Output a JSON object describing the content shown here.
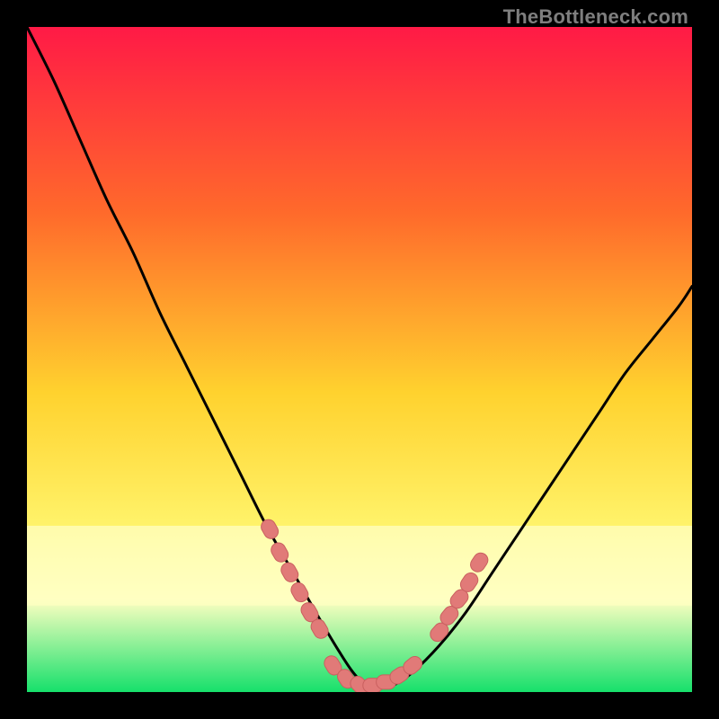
{
  "watermark": "TheBottleneck.com",
  "colors": {
    "frame_bg": "#000000",
    "gradient_top": "#ff1a46",
    "gradient_mid_upper": "#ff6a2b",
    "gradient_mid": "#ffd22e",
    "gradient_mid_lower": "#fff36a",
    "gradient_pale_band": "#ffffc2",
    "gradient_bottom": "#16e06b",
    "curve": "#000000",
    "marker_fill": "#e17a78",
    "marker_stroke": "#c9605f"
  },
  "chart_data": {
    "type": "line",
    "title": "",
    "xlabel": "",
    "ylabel": "",
    "xlim": [
      0,
      100
    ],
    "ylim": [
      0,
      100
    ],
    "grid": false,
    "legend": false,
    "comment": "Bottleneck-style V-curve. x is a normalized component-ratio axis (0-100), y is bottleneck percentage (0 = no bottleneck, 100 = full bottleneck). Values are read off the plot by position against the square frame; no numeric axis labels are rendered in the image.",
    "series": [
      {
        "name": "bottleneck-curve",
        "x": [
          0,
          4,
          8,
          12,
          16,
          20,
          24,
          28,
          32,
          36,
          40,
          44,
          47,
          49,
          51,
          53,
          55,
          58,
          62,
          66,
          70,
          74,
          78,
          82,
          86,
          90,
          94,
          98,
          100
        ],
        "y": [
          100,
          92,
          83,
          74,
          66,
          57,
          49,
          41,
          33,
          25,
          18,
          11,
          6,
          3,
          1,
          1,
          1,
          3,
          7,
          12,
          18,
          24,
          30,
          36,
          42,
          48,
          53,
          58,
          61
        ]
      }
    ],
    "markers": [
      {
        "name": "left-arm-dots",
        "x": [
          36.5,
          38.0,
          39.5,
          41.0,
          42.5,
          44.0
        ],
        "y": [
          24.5,
          21.0,
          18.0,
          15.0,
          12.0,
          9.5
        ]
      },
      {
        "name": "valley-dots",
        "x": [
          46.0,
          48.0,
          50.0,
          52.0,
          54.0,
          56.0,
          58.0
        ],
        "y": [
          4.0,
          2.0,
          1.0,
          1.0,
          1.5,
          2.5,
          4.0
        ]
      },
      {
        "name": "right-arm-dots",
        "x": [
          62.0,
          63.5,
          65.0,
          66.5,
          68.0
        ],
        "y": [
          9.0,
          11.5,
          14.0,
          16.5,
          19.5
        ]
      }
    ]
  }
}
